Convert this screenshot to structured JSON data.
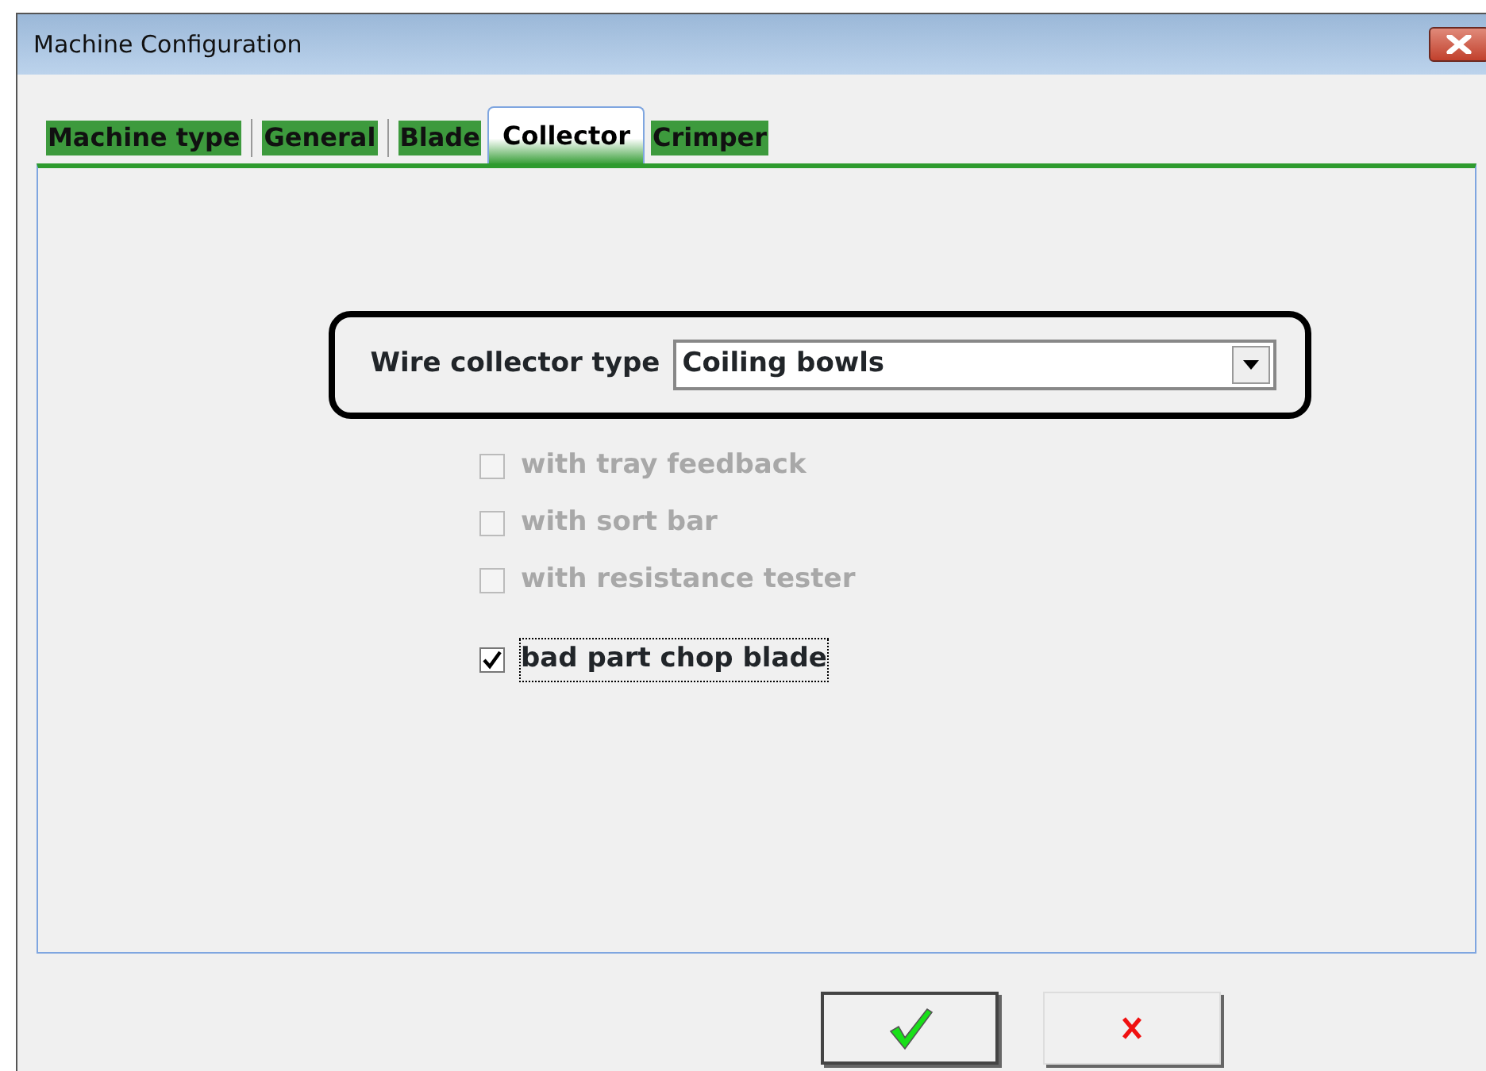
{
  "window": {
    "title": "Machine Configuration"
  },
  "tabs": [
    {
      "label": "Machine type",
      "selected": false
    },
    {
      "label": "General",
      "selected": false
    },
    {
      "label": "Blade",
      "selected": false
    },
    {
      "label": "Collector",
      "selected": true
    },
    {
      "label": "Crimper",
      "selected": false
    }
  ],
  "collector": {
    "label": "Wire collector type",
    "value": "Coiling bowls"
  },
  "options": [
    {
      "label": "with tray feedback",
      "checked": false,
      "disabled": true,
      "focused": false
    },
    {
      "label": "with sort bar",
      "checked": false,
      "disabled": true,
      "focused": false
    },
    {
      "label": "with resistance tester",
      "checked": false,
      "disabled": true,
      "focused": false
    },
    {
      "label": "bad part chop blade",
      "checked": true,
      "disabled": false,
      "focused": true
    }
  ],
  "buttons": [
    {
      "kind": "ok"
    },
    {
      "kind": "cancel"
    }
  ]
}
